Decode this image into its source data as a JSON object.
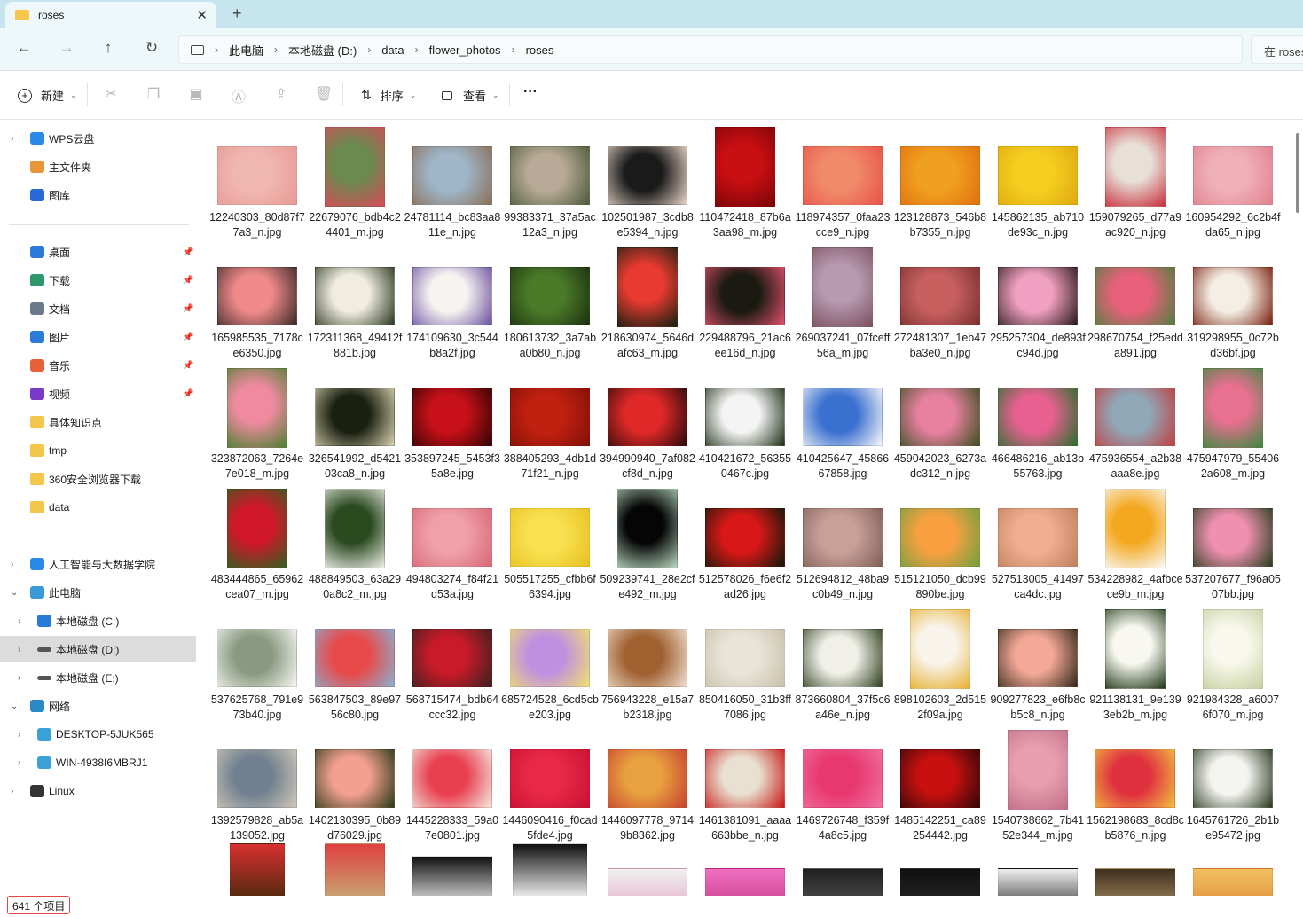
{
  "window": {
    "tab_title": "roses",
    "close_glyph": "✕",
    "new_tab_glyph": "+"
  },
  "nav": {
    "back": "←",
    "forward": "→",
    "up": "↑",
    "refresh": "↻"
  },
  "breadcrumb": [
    "此电脑",
    "本地磁盘 (D:)",
    "data",
    "flower_photos",
    "roses"
  ],
  "search": {
    "placeholder": "在 roses 中搜索"
  },
  "toolbar": {
    "new_label": "新建",
    "sort_label": "排序",
    "view_label": "查看",
    "more_label": "···"
  },
  "sidebar": {
    "top": [
      {
        "label": "WPS云盘",
        "icon": "cloud-icon",
        "chev": true
      },
      {
        "label": "主文件夹",
        "icon": "home-icon"
      },
      {
        "label": "图库",
        "icon": "gallery-icon"
      }
    ],
    "quick": [
      {
        "label": "桌面",
        "icon": "desktop-icon",
        "pinned": true
      },
      {
        "label": "下载",
        "icon": "download-icon",
        "pinned": true
      },
      {
        "label": "文档",
        "icon": "document-icon",
        "pinned": true
      },
      {
        "label": "图片",
        "icon": "picture-icon",
        "pinned": true
      },
      {
        "label": "音乐",
        "icon": "music-icon",
        "pinned": true
      },
      {
        "label": "视频",
        "icon": "video-icon",
        "pinned": true
      },
      {
        "label": "具体知识点",
        "icon": "folder-icon"
      },
      {
        "label": "tmp",
        "icon": "folder-icon"
      },
      {
        "label": "360安全浏览器下载",
        "icon": "folder-icon"
      },
      {
        "label": "data",
        "icon": "folder-icon"
      }
    ],
    "tree": [
      {
        "label": "人工智能与大数据学院",
        "icon": "cloud-folder-icon",
        "level": 0,
        "chev": "›"
      },
      {
        "label": "此电脑",
        "icon": "pc-icon",
        "level": 0,
        "chev": "⌄"
      },
      {
        "label": "本地磁盘 (C:)",
        "icon": "windows-drive-icon",
        "level": 1,
        "chev": "›"
      },
      {
        "label": "本地磁盘 (D:)",
        "icon": "drive-icon",
        "level": 1,
        "chev": "›",
        "selected": true
      },
      {
        "label": "本地磁盘 (E:)",
        "icon": "drive-icon",
        "level": 1,
        "chev": "›"
      },
      {
        "label": "网络",
        "icon": "network-icon",
        "level": 0,
        "chev": "⌄"
      },
      {
        "label": "DESKTOP-5JUK565",
        "icon": "monitor-icon",
        "level": 1,
        "chev": "›"
      },
      {
        "label": "WIN-4938I6MBRJ1",
        "icon": "monitor-icon",
        "level": 1,
        "chev": "›"
      },
      {
        "label": "Linux",
        "icon": "linux-icon",
        "level": 0,
        "chev": "›"
      }
    ]
  },
  "files": [
    {
      "name": "12240303_80d87f77a3_n.jpg",
      "colors": [
        "#f0b7b0",
        "#e89a95"
      ],
      "shape": "land"
    },
    {
      "name": "22679076_bdb4c24401_m.jpg",
      "colors": [
        "#6b8a4e",
        "#d64b5a"
      ],
      "shape": "port"
    },
    {
      "name": "24781114_bc83aa811e_n.jpg",
      "colors": [
        "#9eb6c8",
        "#8a6f58"
      ],
      "shape": "land"
    },
    {
      "name": "99383371_37a5ac12a3_n.jpg",
      "colors": [
        "#b8aa96",
        "#4c5a3a"
      ],
      "shape": "land"
    },
    {
      "name": "102501987_3cdb8e5394_n.jpg",
      "colors": [
        "#1a1a1a",
        "#e8d5c8"
      ],
      "shape": "land"
    },
    {
      "name": "110472418_87b6a3aa98_m.jpg",
      "colors": [
        "#c80f12",
        "#7a0408"
      ],
      "shape": "port"
    },
    {
      "name": "118974357_0faa23cce9_n.jpg",
      "colors": [
        "#f08a6a",
        "#e8544a"
      ],
      "shape": "land"
    },
    {
      "name": "123128873_546b8b7355_n.jpg",
      "colors": [
        "#f0a020",
        "#e07010"
      ],
      "shape": "land"
    },
    {
      "name": "145862135_ab710de93c_n.jpg",
      "colors": [
        "#f4cf20",
        "#e0a810"
      ],
      "shape": "land"
    },
    {
      "name": "159079265_d77a9ac920_n.jpg",
      "colors": [
        "#e8e0d8",
        "#c8303a"
      ],
      "shape": "port"
    },
    {
      "name": "160954292_6c2b4fda65_n.jpg",
      "colors": [
        "#f0b0b8",
        "#e08290"
      ],
      "shape": "land"
    },
    {
      "name": "165985535_7178ce6350.jpg",
      "colors": [
        "#f08a8a",
        "#3a2a28"
      ],
      "shape": "land"
    },
    {
      "name": "172311368_49412f881b.jpg",
      "colors": [
        "#f0ece0",
        "#2a3820"
      ],
      "shape": "land"
    },
    {
      "name": "174109630_3c544b8a2f.jpg",
      "colors": [
        "#f6f4f0",
        "#6a50a0"
      ],
      "shape": "land"
    },
    {
      "name": "180613732_3a7aba0b80_n.jpg",
      "colors": [
        "#4a7a28",
        "#1c3010"
      ],
      "shape": "land"
    },
    {
      "name": "218630974_5646dafc63_m.jpg",
      "colors": [
        "#e83a30",
        "#102010"
      ],
      "shape": "port"
    },
    {
      "name": "229488796_21ac6ee16d_n.jpg",
      "colors": [
        "#1a1a12",
        "#e0506a"
      ],
      "shape": "land"
    },
    {
      "name": "269037241_07fceff56a_m.jpg",
      "colors": [
        "#b89ab0",
        "#7a5060"
      ],
      "shape": "port"
    },
    {
      "name": "272481307_1eb47ba3e0_n.jpg",
      "colors": [
        "#c86060",
        "#7a3030"
      ],
      "shape": "land"
    },
    {
      "name": "295257304_de893fc94d.jpg",
      "colors": [
        "#f0a0c0",
        "#2a1a1a"
      ],
      "shape": "land"
    },
    {
      "name": "298670754_f25edda891.jpg",
      "colors": [
        "#e8607a",
        "#508040"
      ],
      "shape": "land"
    },
    {
      "name": "319298955_0c72bd36bf.jpg",
      "colors": [
        "#f4eee4",
        "#7a2010"
      ],
      "shape": "land"
    },
    {
      "name": "323872063_7264e7e018_m.jpg",
      "colors": [
        "#f08aa0",
        "#4a8030"
      ],
      "shape": "port"
    },
    {
      "name": "326541992_d542103ca8_n.jpg",
      "colors": [
        "#1a2010",
        "#d8d0b0"
      ],
      "shape": "land"
    },
    {
      "name": "353897245_5453f35a8e.jpg",
      "colors": [
        "#c81018",
        "#300404"
      ],
      "shape": "land"
    },
    {
      "name": "388405293_4db1d71f21_n.jpg",
      "colors": [
        "#c02010",
        "#801008"
      ],
      "shape": "land"
    },
    {
      "name": "394990940_7af082cf8d_n.jpg",
      "colors": [
        "#e02828",
        "#2a0a0a"
      ],
      "shape": "land"
    },
    {
      "name": "410421672_563550467c.jpg",
      "colors": [
        "#f4f4f4",
        "#203018"
      ],
      "shape": "land"
    },
    {
      "name": "410425647_4586667858.jpg",
      "colors": [
        "#3a70d0",
        "#f8f8f8"
      ],
      "shape": "land"
    },
    {
      "name": "459042023_6273adc312_n.jpg",
      "colors": [
        "#e880a0",
        "#3a5020"
      ],
      "shape": "land"
    },
    {
      "name": "466486216_ab13b55763.jpg",
      "colors": [
        "#e86090",
        "#2a7030"
      ],
      "shape": "land"
    },
    {
      "name": "475936554_a2b38aaa8e.jpg",
      "colors": [
        "#90a8b8",
        "#c04040"
      ],
      "shape": "land"
    },
    {
      "name": "475947979_554062a608_m.jpg",
      "colors": [
        "#e87090",
        "#3a8a40"
      ],
      "shape": "port"
    },
    {
      "name": "483444865_65962cea07_m.jpg",
      "colors": [
        "#d01828",
        "#306020"
      ],
      "shape": "port"
    },
    {
      "name": "488849503_63a290a8c2_m.jpg",
      "colors": [
        "#2a4a20",
        "#f0f0e8"
      ],
      "shape": "port"
    },
    {
      "name": "494803274_f84f21d53a.jpg",
      "colors": [
        "#f0a0a8",
        "#d86878"
      ],
      "shape": "land"
    },
    {
      "name": "505517255_cfbb6f6394.jpg",
      "colors": [
        "#f8e050",
        "#e8c020"
      ],
      "shape": "land"
    },
    {
      "name": "509239741_28e2cfe492_m.jpg",
      "colors": [
        "#050505",
        "#b8d8c0"
      ],
      "shape": "port"
    },
    {
      "name": "512578026_f6e6f2ad26.jpg",
      "colors": [
        "#d81818",
        "#101808"
      ],
      "shape": "land"
    },
    {
      "name": "512694812_48ba9c0b49_n.jpg",
      "colors": [
        "#c8a098",
        "#806058"
      ],
      "shape": "land"
    },
    {
      "name": "515121050_dcb99890be.jpg",
      "colors": [
        "#f8a040",
        "#70a040"
      ],
      "shape": "land"
    },
    {
      "name": "527513005_41497ca4dc.jpg",
      "colors": [
        "#f0b090",
        "#c08060"
      ],
      "shape": "land"
    },
    {
      "name": "534228982_4afbcece9b_m.jpg",
      "colors": [
        "#f4a820",
        "#fafafa"
      ],
      "shape": "port"
    },
    {
      "name": "537207677_f96a0507bb.jpg",
      "colors": [
        "#f090b0",
        "#2a4020"
      ],
      "shape": "land"
    },
    {
      "name": "537625768_791e973b40.jpg",
      "colors": [
        "#8a9a80",
        "#f8f8f4"
      ],
      "shape": "land"
    },
    {
      "name": "563847503_89e9756c80.jpg",
      "colors": [
        "#e84a4a",
        "#8ab0d0"
      ],
      "shape": "land"
    },
    {
      "name": "568715474_bdb64ccc32.jpg",
      "colors": [
        "#c81a28",
        "#3a2020"
      ],
      "shape": "land"
    },
    {
      "name": "685724528_6cd5cbe203.jpg",
      "colors": [
        "#c090e0",
        "#f0e070"
      ],
      "shape": "land"
    },
    {
      "name": "756943228_e15a7b2318.jpg",
      "colors": [
        "#a06030",
        "#f0e0d0"
      ],
      "shape": "land"
    },
    {
      "name": "850416050_31b3ff7086.jpg",
      "colors": [
        "#e8e4d8",
        "#c8c0a8"
      ],
      "shape": "land"
    },
    {
      "name": "873660804_37f5c6a46e_n.jpg",
      "colors": [
        "#f0f0e8",
        "#304020"
      ],
      "shape": "land"
    },
    {
      "name": "898102603_2d5152f09a.jpg",
      "colors": [
        "#f8f4ec",
        "#e8b030"
      ],
      "shape": "port"
    },
    {
      "name": "909277823_e6fb8cb5c8_n.jpg",
      "colors": [
        "#f4a898",
        "#302818"
      ],
      "shape": "land"
    },
    {
      "name": "921138131_9e1393eb2b_m.jpg",
      "colors": [
        "#f8f8f0",
        "#203818"
      ],
      "shape": "port"
    },
    {
      "name": "921984328_a60076f070_m.jpg",
      "colors": [
        "#f8f8ec",
        "#c8d0a0"
      ],
      "shape": "port"
    },
    {
      "name": "1392579828_ab5a139052.jpg",
      "colors": [
        "#708090",
        "#d0c8b8"
      ],
      "shape": "land"
    },
    {
      "name": "1402130395_0b89d76029.jpg",
      "colors": [
        "#f4a090",
        "#2a3a18"
      ],
      "shape": "land"
    },
    {
      "name": "1445228333_59a07e0801.jpg",
      "colors": [
        "#e84050",
        "#f4e8e0"
      ],
      "shape": "land"
    },
    {
      "name": "1446090416_f0cad5fde4.jpg",
      "colors": [
        "#e82848",
        "#c81030"
      ],
      "shape": "land"
    },
    {
      "name": "1446097778_97149b8362.jpg",
      "colors": [
        "#e8a040",
        "#c84030"
      ],
      "shape": "land"
    },
    {
      "name": "1461381091_aaaa663bbe_n.jpg",
      "colors": [
        "#e8e0d0",
        "#c81818"
      ],
      "shape": "land"
    },
    {
      "name": "1469726748_f359f4a8c5.jpg",
      "colors": [
        "#e83870",
        "#f070a0"
      ],
      "shape": "land"
    },
    {
      "name": "1485142251_ca89254442.jpg",
      "colors": [
        "#c81010",
        "#300808"
      ],
      "shape": "land"
    },
    {
      "name": "1540738662_7b4152e344_m.jpg",
      "colors": [
        "#e8a0b0",
        "#c07088"
      ],
      "shape": "port"
    },
    {
      "name": "1562198683_8cd8cb5876_n.jpg",
      "colors": [
        "#e03040",
        "#f0c040"
      ],
      "shape": "land"
    },
    {
      "name": "1645761726_2b1be95472.jpg",
      "colors": [
        "#f4f4f0",
        "#2a3a20"
      ],
      "shape": "land"
    }
  ],
  "status": {
    "count_text": "641 个项目"
  }
}
